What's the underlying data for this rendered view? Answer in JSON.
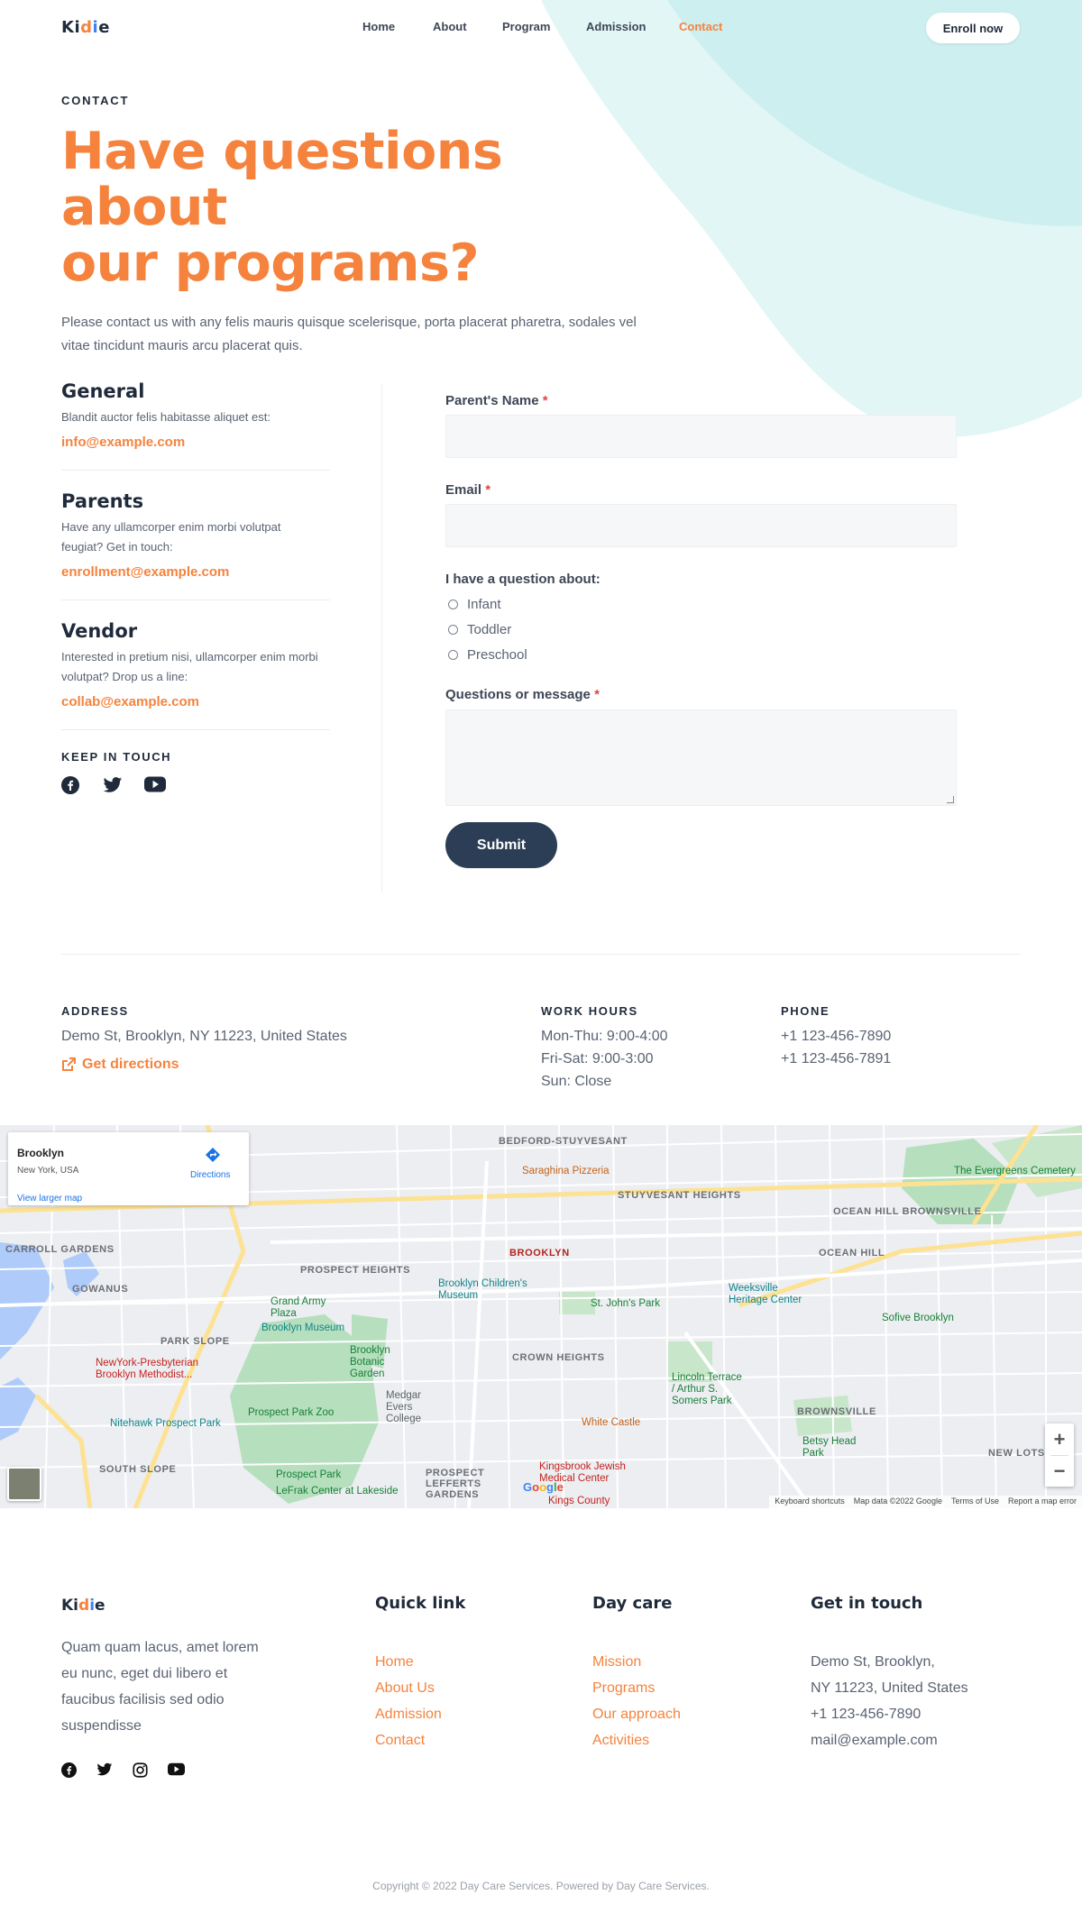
{
  "brand": {
    "name": "Kidie",
    "accent": "#f5833d",
    "dark": "#2c3e55"
  },
  "nav": {
    "items": [
      {
        "label": "Home"
      },
      {
        "label": "About"
      },
      {
        "label": "Program"
      },
      {
        "label": "Admission"
      },
      {
        "label": "Contact",
        "active": true
      }
    ],
    "cta": "Enroll now"
  },
  "hero": {
    "eyebrow": "CONTACT",
    "title_line1": "Have questions about",
    "title_line2": "our programs?",
    "description": "Please contact us with any felis mauris quisque scelerisque, porta placerat pharetra, sodales vel vitae tincidunt mauris arcu placerat quis."
  },
  "contacts": [
    {
      "title": "General",
      "text": "Blandit auctor felis habitasse aliquet est:",
      "email": "info@example.com"
    },
    {
      "title": "Parents",
      "text": "Have any ullamcorper enim morbi volutpat feugiat? Get in touch:",
      "email": "enrollment@example.com"
    },
    {
      "title": "Vendor",
      "text": "Interested in pretium nisi, ullamcorper enim morbi volutpat? Drop us a line:",
      "email": "collab@example.com"
    }
  ],
  "keep_in_touch": {
    "label": "KEEP IN TOUCH",
    "icons": [
      "facebook-icon",
      "twitter-icon",
      "youtube-icon"
    ]
  },
  "form": {
    "name_label": "Parent's Name",
    "email_label": "Email",
    "question_label": "I have a question about:",
    "options": [
      "Infant",
      "Toddler",
      "Preschool"
    ],
    "message_label": "Questions or message",
    "required_mark": "*",
    "submit": "Submit"
  },
  "info": {
    "address": {
      "label": "ADDRESS",
      "line": "Demo St, Brooklyn, NY 11223, United States",
      "directions": "Get directions"
    },
    "hours": {
      "label": "WORK HOURS",
      "lines": [
        "Mon-Thu: 9:00-4:00",
        "Fri-Sat: 9:00-3:00",
        "Sun: Close"
      ]
    },
    "phone": {
      "label": "PHONE",
      "lines": [
        "+1 123-456-7890",
        "+1 123-456-7891"
      ]
    }
  },
  "map": {
    "card_title": "Brooklyn",
    "card_subtitle": "New York, USA",
    "card_link": "View larger map",
    "directions": "Directions",
    "neighborhoods": [
      "BEDFORD-STUYVESANT",
      "STUYVESANT HEIGHTS",
      "OCEAN HILL BROWNSVILLE",
      "CARROLL GARDENS",
      "PROSPECT HEIGHTS",
      "BROOKLYN",
      "OCEAN HILL",
      "GOWANUS",
      "PARK SLOPE",
      "CROWN HEIGHTS",
      "BROWNSVILLE",
      "SOUTH SLOPE",
      "PROSPECT LEFFERTS GARDENS",
      "NEW LOTS"
    ],
    "pois": [
      "Saraghina Pizzeria",
      "The Evergreens Cemetery",
      "Brooklyn Children's Museum",
      "Weeksville Heritage Center",
      "St. John's Park",
      "Brooklyn Museum",
      "Sofive Brooklyn",
      "NewYork-Presbyterian Brooklyn Methodist...",
      "Brooklyn Botanic Garden",
      "Medgar Evers College",
      "Lincoln Terrace / Arthur S. Somers Park",
      "Nitehawk Prospect Park",
      "Prospect Park Zoo",
      "White Castle",
      "Betsy Head Park",
      "Kingsbrook Jewish Medical Center",
      "Prospect Park",
      "LeFrak Center at Lakeside",
      "Grand Army Plaza",
      "Kings County"
    ],
    "attribution": [
      "Keyboard shortcuts",
      "Map data ©2022 Google",
      "Terms of Use",
      "Report a map error"
    ],
    "zoom_in": "+",
    "zoom_out": "−",
    "google": "Google"
  },
  "footer": {
    "logo": "Kidie",
    "description": "Quam quam lacus, amet lorem eu nunc, eget dui libero et faucibus facilisis sed odio suspendisse",
    "quick_link": {
      "title": "Quick link",
      "items": [
        "Home",
        "About Us",
        "Admission",
        "Contact"
      ]
    },
    "day_care": {
      "title": "Day care",
      "items": [
        "Mission",
        "Programs",
        "Our approach",
        "Activities"
      ]
    },
    "get_in_touch": {
      "title": "Get in touch",
      "items": [
        "Demo St, Brooklyn,",
        "NY 11223, United States",
        "+1 123-456-7890",
        "mail@example.com"
      ]
    },
    "social_icons": [
      "facebook-icon",
      "twitter-icon",
      "instagram-icon",
      "youtube-icon"
    ],
    "copyright": "Copyright © 2022 Day Care Services. Powered by Day Care Services."
  }
}
